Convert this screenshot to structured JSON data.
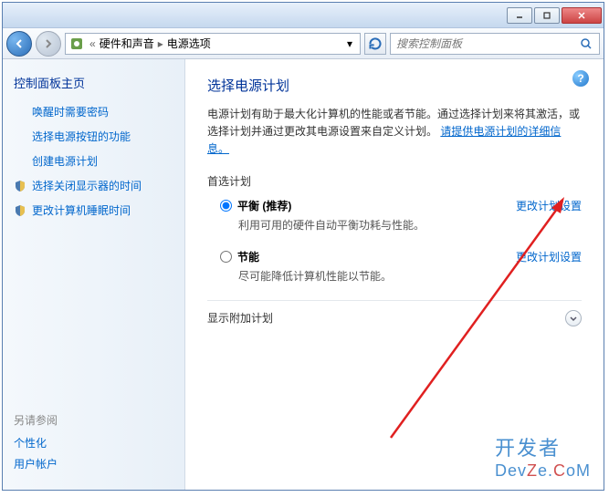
{
  "breadcrumb": {
    "item1": "硬件和声音",
    "item2": "电源选项"
  },
  "search": {
    "placeholder": "搜索控制面板"
  },
  "sidebar": {
    "home": "控制面板主页",
    "items": [
      {
        "label": "唤醒时需要密码"
      },
      {
        "label": "选择电源按钮的功能"
      },
      {
        "label": "创建电源计划"
      },
      {
        "label": "选择关闭显示器的时间"
      },
      {
        "label": "更改计算机睡眠时间"
      }
    ],
    "see_also": "另请参阅",
    "bottom": [
      {
        "label": "个性化"
      },
      {
        "label": "用户帐户"
      }
    ]
  },
  "main": {
    "heading": "选择电源计划",
    "desc_prefix": "电源计划有助于最大化计算机的性能或者节能。通过选择计划来将其激活，或选择计划并通过更改其电源设置来自定义计划。",
    "desc_link": "请提供电源计划的详细信息。",
    "preferred_label": "首选计划",
    "plans": [
      {
        "name": "平衡 (推荐)",
        "desc": "利用可用的硬件自动平衡功耗与性能。",
        "change": "更改计划设置",
        "selected": true
      },
      {
        "name": "节能",
        "desc": "尽可能降低计算机性能以节能。",
        "change": "更改计划设置",
        "selected": false
      }
    ],
    "additional_label": "显示附加计划"
  },
  "watermark": {
    "line1": "开发者",
    "line2": "DevZe.CoM"
  }
}
